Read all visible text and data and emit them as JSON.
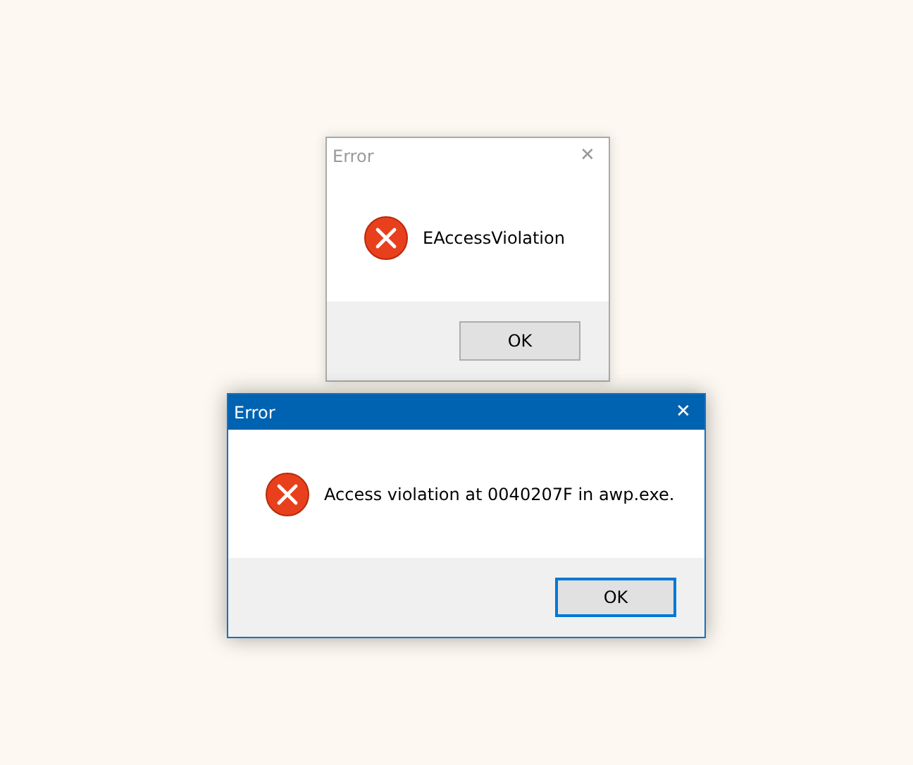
{
  "windows": [
    {
      "title": "Error",
      "active": false,
      "close": "✕",
      "message": "EAccessViolation",
      "buttons": [
        {
          "label": "OK",
          "focused": false
        }
      ]
    },
    {
      "title": "Error",
      "active": true,
      "close": "✕",
      "message": "Access violation at 0040207F in awp.exe.",
      "buttons": [
        {
          "label": "OK",
          "focused": true
        }
      ]
    }
  ]
}
